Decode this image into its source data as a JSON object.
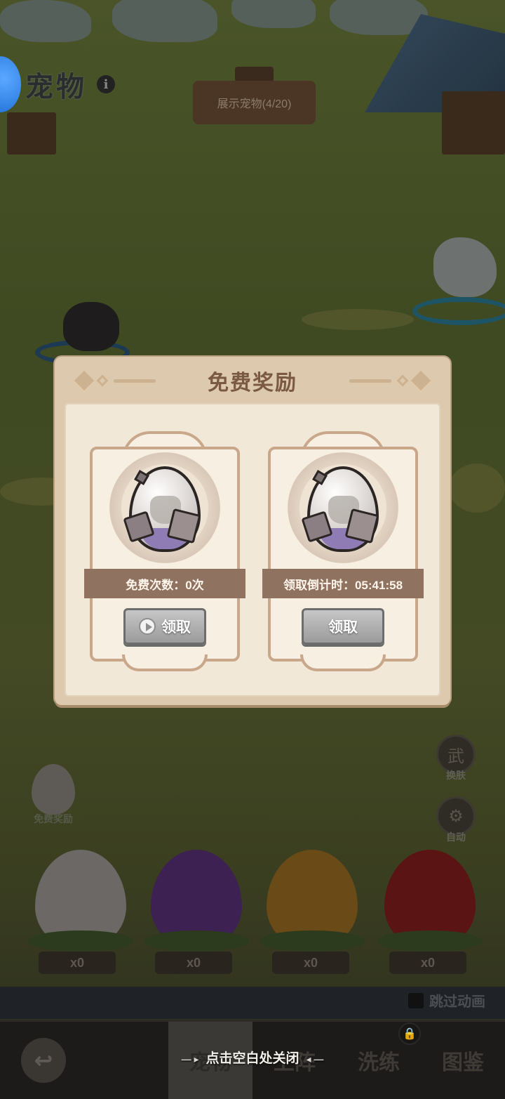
{
  "header": {
    "title": "宠物",
    "info_icon": "i"
  },
  "scene": {
    "sign_text": "展示宠物(4/20)",
    "side_reward_label": "免费奖励",
    "skin_button_icon": "武",
    "skin_button_label": "换肤",
    "auto_button_icon": "⚙",
    "auto_button_label": "自动",
    "egg_counts": [
      "x0",
      "x0",
      "x0",
      "x0"
    ],
    "egg_colors": [
      "#6b6866",
      "#3d2152",
      "#6a4a16",
      "#5a1414"
    ],
    "skip_animation_label": "跳过动画"
  },
  "modal": {
    "title": "免费奖励",
    "cards": [
      {
        "banner": "免费次数：0次",
        "button_label": "领取",
        "has_video_icon": true
      },
      {
        "banner": "领取倒计时：05:41:58",
        "button_label": "领取",
        "has_video_icon": false
      }
    ]
  },
  "tabbar": {
    "back_icon": "↩",
    "tabs": [
      "宠物",
      "上阵",
      "洗练",
      "图鉴"
    ],
    "lock_icon": "🔒"
  },
  "close_hint": "点击空白处关闭"
}
